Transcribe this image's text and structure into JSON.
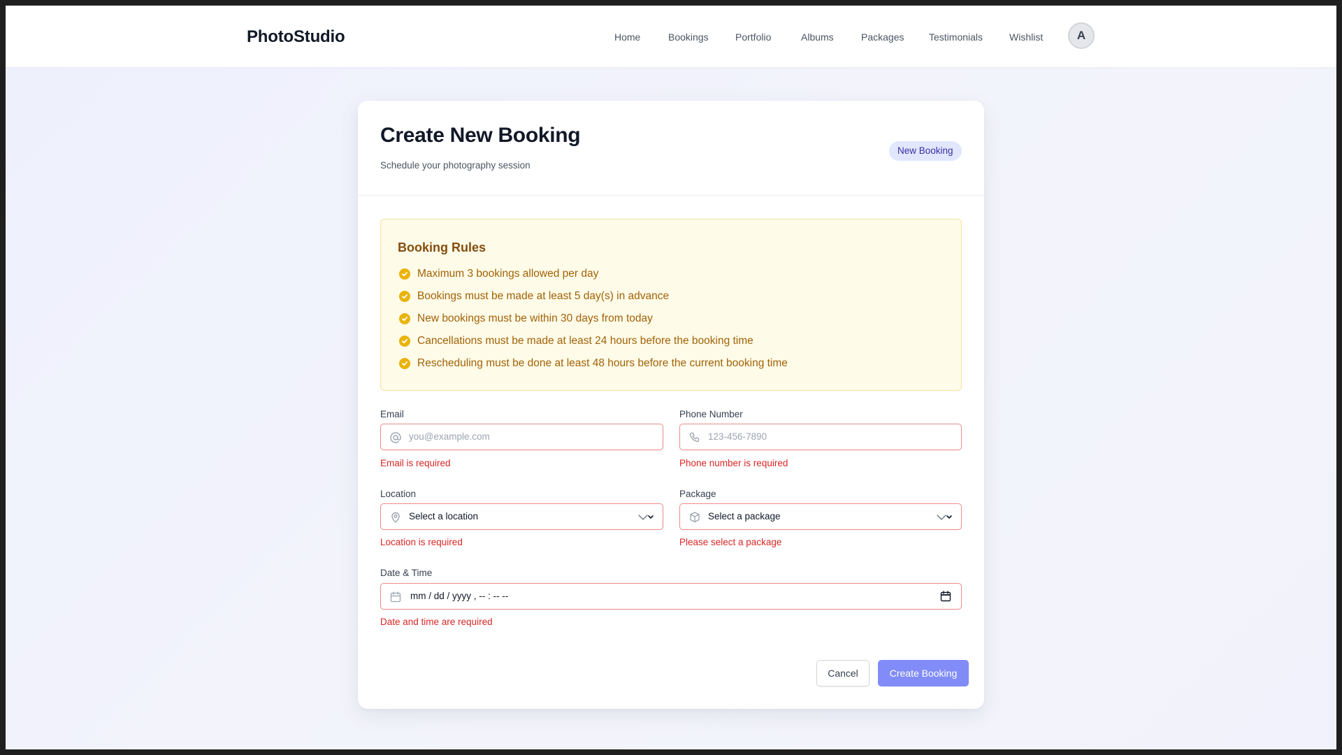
{
  "header": {
    "brand": "PhotoStudio",
    "nav": [
      "Home",
      "Bookings",
      "Portfolio",
      "Albums",
      "Packages",
      "Testimonials",
      "Wishlist"
    ],
    "avatar_initial": "A"
  },
  "card": {
    "title": "Create New Booking",
    "subtitle": "Schedule your photography session",
    "badge": "New Booking"
  },
  "rules": {
    "title": "Booking Rules",
    "items": [
      "Maximum 3 bookings allowed per day",
      "Bookings must be made at least 5 day(s) in advance",
      "New bookings must be within 30 days from today",
      "Cancellations must be made at least 24 hours before the booking time",
      "Rescheduling must be done at least 48 hours before the current booking time"
    ]
  },
  "form": {
    "email": {
      "label": "Email",
      "placeholder": "you@example.com",
      "value": "",
      "error": "Email is required",
      "icon": "at-icon"
    },
    "phone": {
      "label": "Phone Number",
      "placeholder": "123-456-7890",
      "value": "",
      "error": "Phone number is required",
      "icon": "phone-icon"
    },
    "location": {
      "label": "Location",
      "selected": "Select a location",
      "error": "Location is required",
      "icon": "map-pin-icon"
    },
    "package": {
      "label": "Package",
      "selected": "Select a package",
      "error": "Please select a package",
      "icon": "box-icon"
    },
    "datetime": {
      "label": "Date & Time",
      "placeholder": "mm / dd / yyyy ,  -- : --   --",
      "error": "Date and time are required",
      "icon": "calendar-icon"
    }
  },
  "actions": {
    "cancel": "Cancel",
    "submit": "Create Booking"
  },
  "colors": {
    "accent": "#818cf8",
    "error": "#dc2626",
    "rules_bg": "#fefbe8",
    "rules_text": "#a16207",
    "check": "#eab308"
  }
}
